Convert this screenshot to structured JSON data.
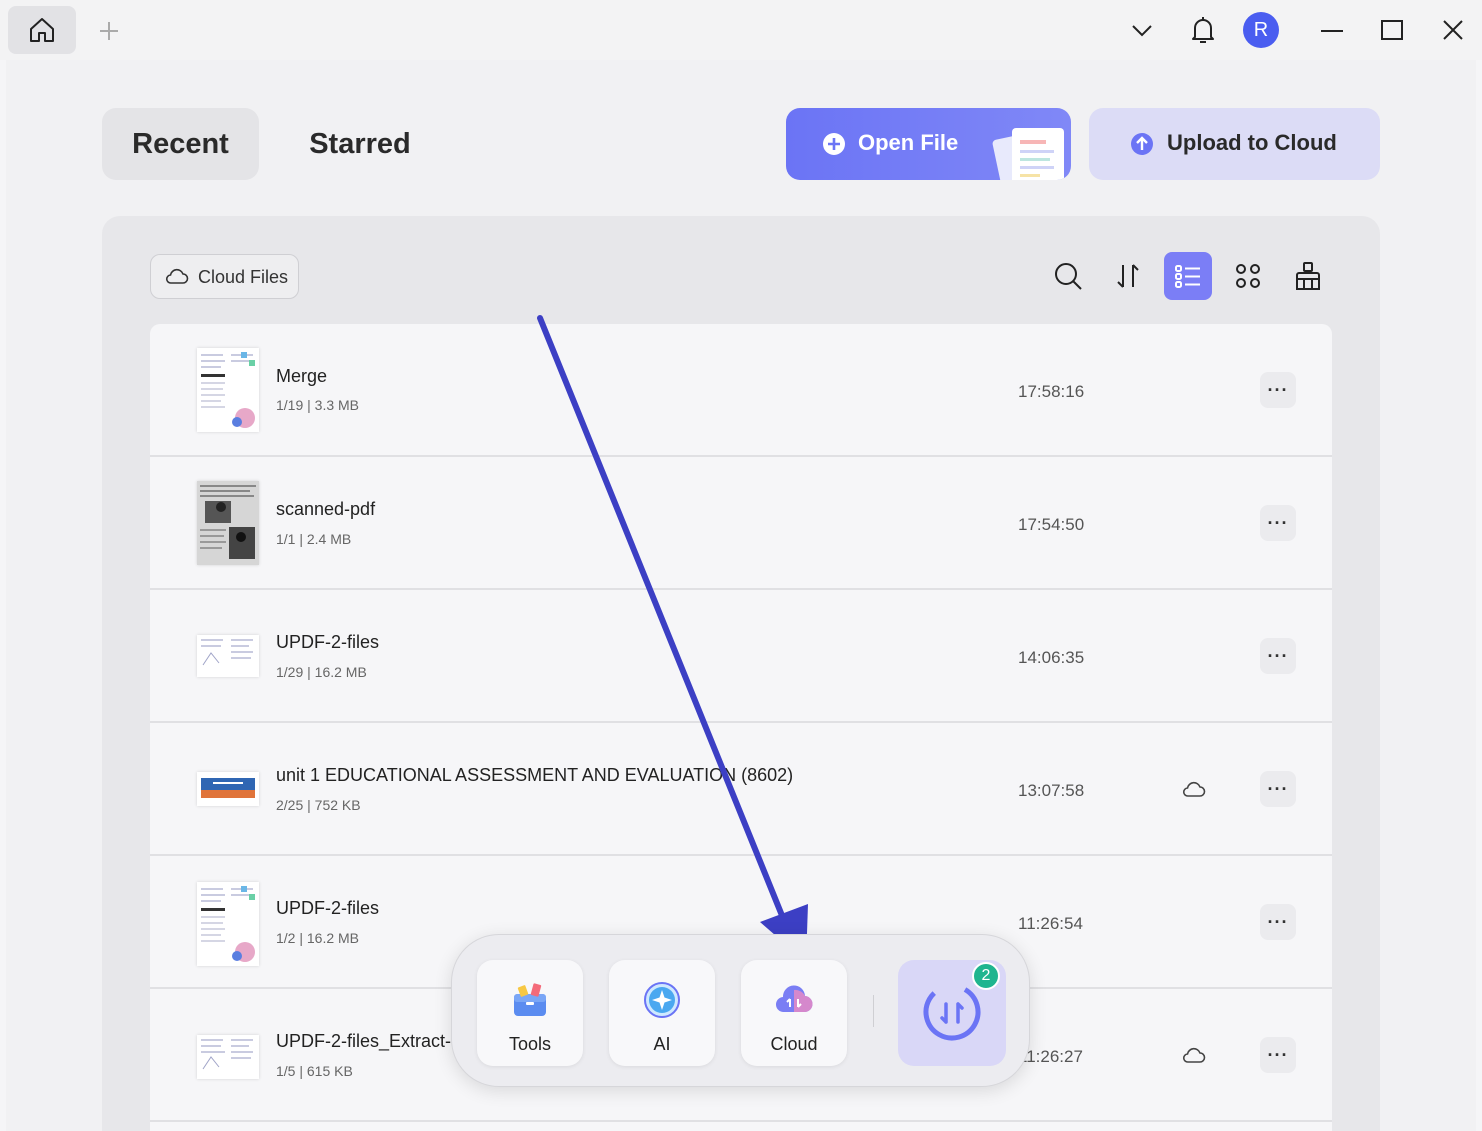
{
  "titlebar": {
    "avatar_initial": "R"
  },
  "tabs": {
    "recent": "Recent",
    "starred": "Starred"
  },
  "actions": {
    "open_file": "Open File",
    "upload_to_cloud": "Upload to Cloud"
  },
  "toolbar": {
    "cloud_files": "Cloud Files"
  },
  "files": [
    {
      "name": "Merge",
      "meta": "1/19 | 3.3 MB",
      "time": "17:58:16",
      "cloud": false
    },
    {
      "name": "scanned-pdf",
      "meta": "1/1 | 2.4 MB",
      "time": "17:54:50",
      "cloud": false
    },
    {
      "name": "UPDF-2-files",
      "meta": "1/29 | 16.2 MB",
      "time": "14:06:35",
      "cloud": false
    },
    {
      "name": "unit 1 EDUCATIONAL ASSESSMENT AND   EVALUATION (8602)",
      "meta": "2/25 | 752 KB",
      "time": "13:07:58",
      "cloud": true
    },
    {
      "name": "UPDF-2-files",
      "meta": "1/2 | 16.2 MB",
      "time": "11:26:54",
      "cloud": false
    },
    {
      "name": "UPDF-2-files_Extract-1",
      "meta": "1/5 | 615 KB",
      "time": "11:26:27",
      "cloud": true
    }
  ],
  "dock": {
    "tools": "Tools",
    "ai": "AI",
    "cloud": "Cloud",
    "sync_badge": "2"
  },
  "colors": {
    "accent": "#6b74f5",
    "upload_bg": "#dcdcf6",
    "arrow": "#3c3fc4",
    "badge": "#1fb58f"
  },
  "more_label": "···"
}
